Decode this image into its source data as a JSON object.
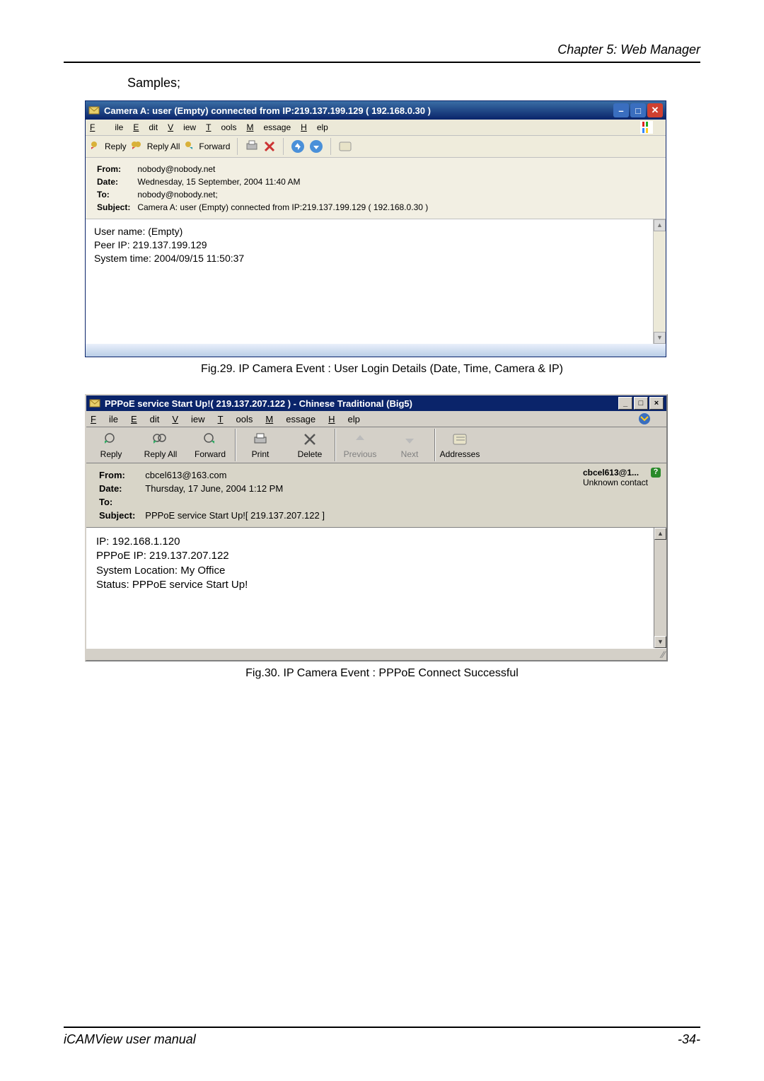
{
  "header": {
    "chapter": "Chapter 5: Web Manager"
  },
  "samples_label": "Samples;",
  "shot1": {
    "title": "Camera A: user (Empty) connected from IP:219.137.199.129 ( 192.168.0.30 )",
    "menus": {
      "file": "File",
      "edit": "Edit",
      "view": "View",
      "tools": "Tools",
      "message": "Message",
      "help": "Help"
    },
    "tools": {
      "reply": "Reply",
      "reply_all": "Reply All",
      "forward": "Forward"
    },
    "headers": {
      "from_lbl": "From:",
      "from": "nobody@nobody.net",
      "date_lbl": "Date:",
      "date": "Wednesday, 15 September, 2004 11:40 AM",
      "to_lbl": "To:",
      "to": "nobody@nobody.net;",
      "subj_lbl": "Subject:",
      "subj": "Camera A: user (Empty) connected from IP:219.137.199.129 ( 192.168.0.30 )"
    },
    "body": {
      "l1": "User name: (Empty)",
      "l2": "Peer IP: 219.137.199.129",
      "l3": "System time: 2004/09/15 11:50:37"
    }
  },
  "caption1": "Fig.29.  IP Camera Event : User Login Details (Date, Time, Camera & IP)",
  "shot2": {
    "title": "PPPoE service Start Up!( 219.137.207.122 ) - Chinese Traditional (Big5)",
    "menus": {
      "file": "File",
      "edit": "Edit",
      "view": "View",
      "tools": "Tools",
      "message": "Message",
      "help": "Help"
    },
    "tools": {
      "reply": "Reply",
      "reply_all": "Reply All",
      "forward": "Forward",
      "print": "Print",
      "delete": "Delete",
      "previous": "Previous",
      "next": "Next",
      "addresses": "Addresses"
    },
    "headers": {
      "from_lbl": "From:",
      "from": "cbcel613@163.com",
      "date_lbl": "Date:",
      "date": "Thursday, 17 June, 2004 1:12 PM",
      "to_lbl": "To:",
      "to": "",
      "subj_lbl": "Subject:",
      "subj": "PPPoE service Start Up![ 219.137.207.122 ]"
    },
    "contact": {
      "name": "cbcel613@1...",
      "sub": "Unknown contact",
      "badge": "?"
    },
    "body": {
      "l1": "IP: 192.168.1.120",
      "l2": "PPPoE IP: 219.137.207.122",
      "l3": "System Location: My Office",
      "l4": "Status: PPPoE service Start Up!"
    }
  },
  "caption2": "Fig.30.  IP Camera Event : PPPoE Connect Successful",
  "footer": {
    "left": "iCAMView  user  manual",
    "right": "-34-"
  }
}
